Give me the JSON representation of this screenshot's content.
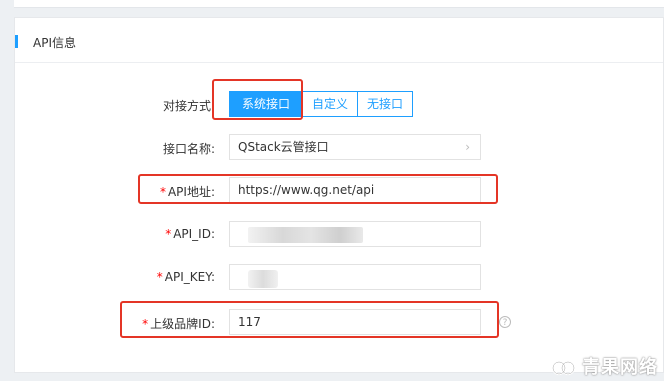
{
  "section": {
    "title": "API信息"
  },
  "form": {
    "method": {
      "label": "对接方式:",
      "options": [
        "系统接口",
        "自定义",
        "无接口"
      ],
      "selected": "系统接口"
    },
    "interface_name": {
      "label": "接口名称:",
      "value": "QStack云管接口"
    },
    "api_url": {
      "required_mark": "*",
      "label": "API地址:",
      "value": "https://www.qg.net/api"
    },
    "api_id": {
      "required_mark": "*",
      "label": "API_ID:",
      "value": ""
    },
    "api_key": {
      "required_mark": "*",
      "label": "API_KEY:",
      "value": ""
    },
    "parent_brand_id": {
      "required_mark": "*",
      "label": "上级品牌ID:",
      "value": "117"
    }
  },
  "icons": {
    "help": "question-circle-icon",
    "select_arrow": "chevron-right-icon",
    "logo": "qingguo-logo-icon"
  },
  "watermark": {
    "text": "青果网络"
  },
  "colors": {
    "accent": "#1e9fff",
    "highlight": "#e43526",
    "required": "#ff0000"
  }
}
